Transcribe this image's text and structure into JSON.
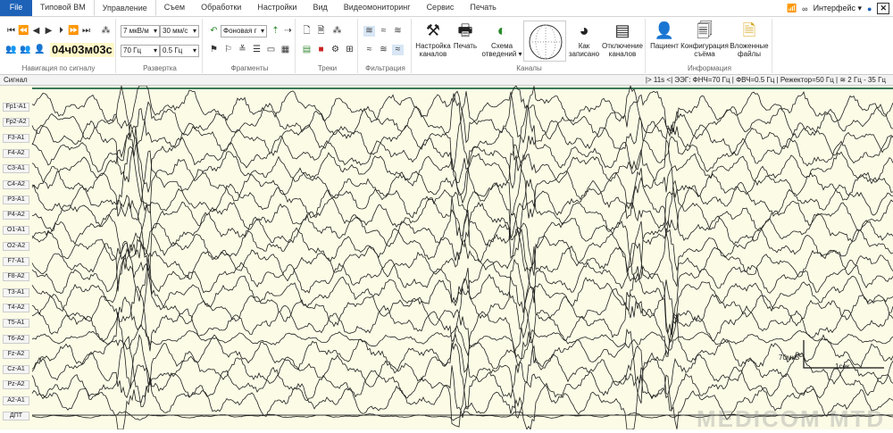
{
  "tabs": [
    "File",
    "Типовой ВМ",
    "Управление",
    "Съем",
    "Обработки",
    "Настройки",
    "Вид",
    "Видеомониторинг",
    "Сервис",
    "Печать"
  ],
  "active_tab": "Управление",
  "top_right": {
    "interface": "Интерфейс ▾"
  },
  "ribbon": {
    "navigation": {
      "label": "Навигация по сигналу",
      "timer": "04ч03м03с"
    },
    "sweep": {
      "label": "Развертка",
      "sensitivity": "7 мкВ/м",
      "speed": "30 мм/с",
      "lowpass": "70 Гц",
      "highpass": "0.5 Гц"
    },
    "fragments": {
      "label": "Фрагменты",
      "fragment": "Фоновая г"
    },
    "tracks": {
      "label": "Треки"
    },
    "filtering": {
      "label": "Фильтрация"
    },
    "channels": {
      "label": "Каналы",
      "buttons": [
        "Настройка каналов",
        "Печать",
        "Схема отведений ▾",
        "Как записано",
        "Отключение каналов"
      ]
    },
    "info": {
      "label": "Информация",
      "buttons": [
        "Пациент",
        "Конфигурация съёма",
        "Вложенные файлы"
      ]
    }
  },
  "signal_bar": {
    "title": "Сигнал",
    "status": "|> 11s <|   ЭЭГ: ФНЧ=70 Гц | ФВЧ=0.5 Гц | Режектор=50 Гц |  ≋ 2 Гц - 35 Гц"
  },
  "channels": [
    "Fp1-A1",
    "Fp2-A2",
    "F3-A1",
    "F4-A2",
    "C3-A1",
    "C4-A2",
    "P3-A1",
    "P4-A2",
    "O1-A1",
    "O2-A2",
    "F7-A1",
    "F8-A2",
    "T3-A1",
    "T4-A2",
    "T5-A1",
    "T6-A2",
    "Fz-A2",
    "Cz-A1",
    "Pz-A2",
    "A2-A1",
    "ДПТ"
  ],
  "scale": {
    "amplitude": "70мкВ",
    "time": "1сек"
  },
  "watermark": "MEDICOM MTD"
}
